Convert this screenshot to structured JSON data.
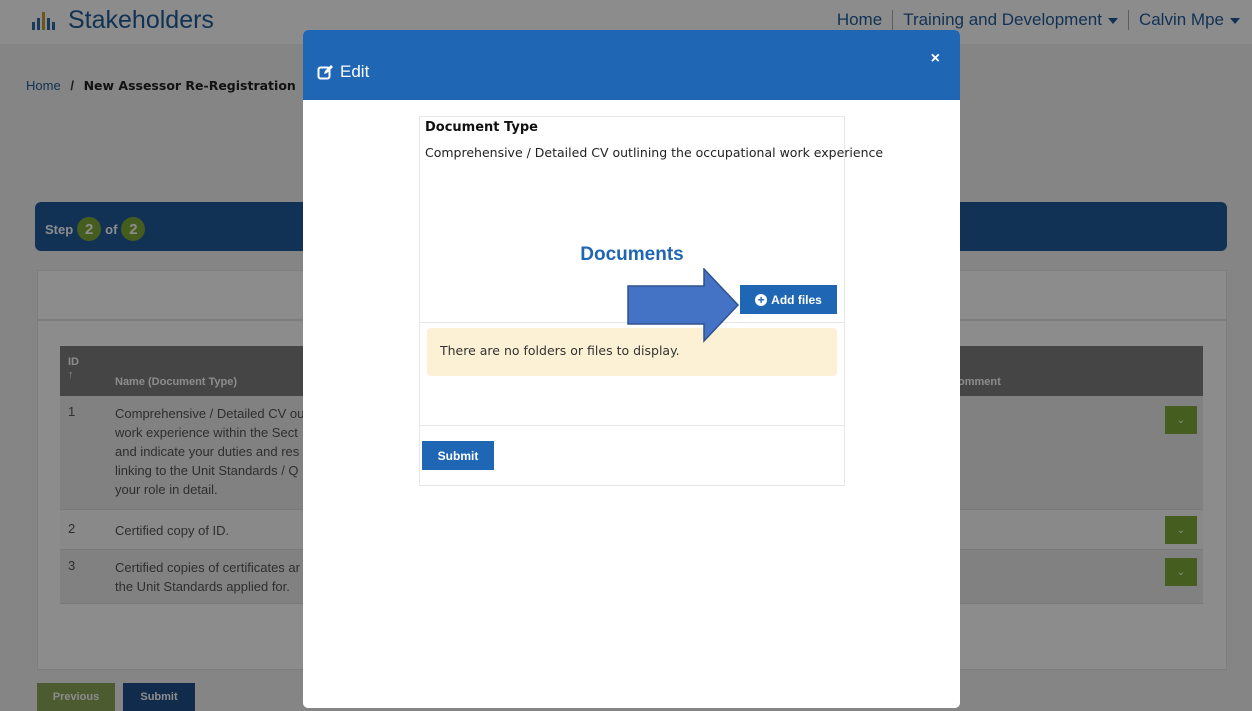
{
  "header": {
    "brand_title": "Stakeholders",
    "nav": {
      "home": "Home",
      "training": "Training and Development",
      "user": "Calvin Mpe"
    }
  },
  "breadcrumb": {
    "home": "Home",
    "separator": "/",
    "current": "New Assessor Re-Registration"
  },
  "stepper": {
    "prefix": "Step",
    "current": "2",
    "of_label": "of",
    "total": "2"
  },
  "table": {
    "headers": {
      "id": "ID",
      "sort_glyph": "↑",
      "name": "Name (Document Type)",
      "comment": "omment"
    },
    "rows": [
      {
        "id": "1",
        "name_lines": [
          "Comprehensive / Detailed CV ou",
          "work experience within the Sect",
          "and indicate your duties and res",
          "linking to the Unit Standards / Q",
          "your role in detail."
        ]
      },
      {
        "id": "2",
        "name_lines": [
          "Certified copy of ID."
        ]
      },
      {
        "id": "3",
        "name_lines": [
          "Certified copies of certificates ar",
          "the Unit Standards applied for."
        ]
      }
    ]
  },
  "footer": {
    "previous": "Previous",
    "submit": "Submit"
  },
  "modal": {
    "title": "Edit",
    "close": "×",
    "doc_type_label": "Document Type",
    "doc_type_value": "Comprehensive / Detailed CV outlining the occupational work experience",
    "documents_heading": "Documents",
    "add_files": "Add files",
    "empty_message": "There are no folders or files to display.",
    "submit": "Submit"
  },
  "colors": {
    "primary_blue": "#1f67b4",
    "step_green": "#7faa3a",
    "empty_message_bg": "#fcf1d4",
    "arrow_fill": "#4472c4"
  }
}
